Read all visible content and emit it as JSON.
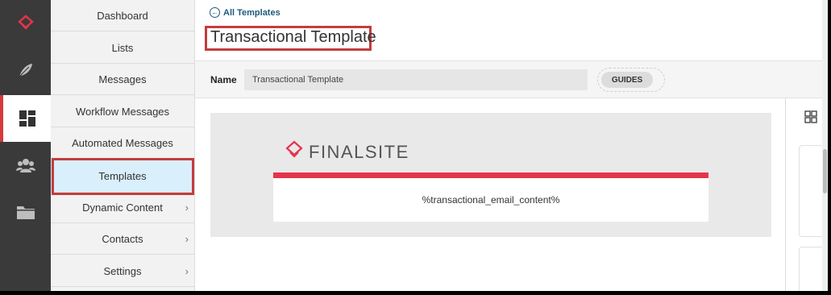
{
  "rail": {
    "items": [
      {
        "icon": "finalsite-logo-icon"
      },
      {
        "icon": "feather-icon"
      },
      {
        "icon": "dashboard-grid-icon",
        "active": true
      },
      {
        "icon": "users-group-icon"
      },
      {
        "icon": "folder-icon"
      }
    ]
  },
  "subnav": {
    "items": [
      {
        "label": "Dashboard"
      },
      {
        "label": "Lists"
      },
      {
        "label": "Messages"
      },
      {
        "label": "Workflow Messages"
      },
      {
        "label": "Automated Messages"
      },
      {
        "label": "Templates",
        "selected": true
      },
      {
        "label": "Dynamic Content",
        "has_submenu": true
      },
      {
        "label": "Contacts",
        "has_submenu": true
      },
      {
        "label": "Settings",
        "has_submenu": true
      }
    ],
    "chevron": "›"
  },
  "header": {
    "back_link": "All Templates",
    "back_icon": "←",
    "title": "Transactional Template"
  },
  "namebar": {
    "label": "Name",
    "value": "Transactional Template",
    "guides_label": "GUIDES"
  },
  "email_preview": {
    "logo_text": "FINALSITE",
    "content": "%transactional_email_content%",
    "accent_color": "#e6344a"
  },
  "side_panel": {
    "letter": "("
  },
  "colors": {
    "rail_bg": "#3a3a3a",
    "highlight_border": "#c43d3d",
    "selected_nav_bg": "#d9effb"
  }
}
